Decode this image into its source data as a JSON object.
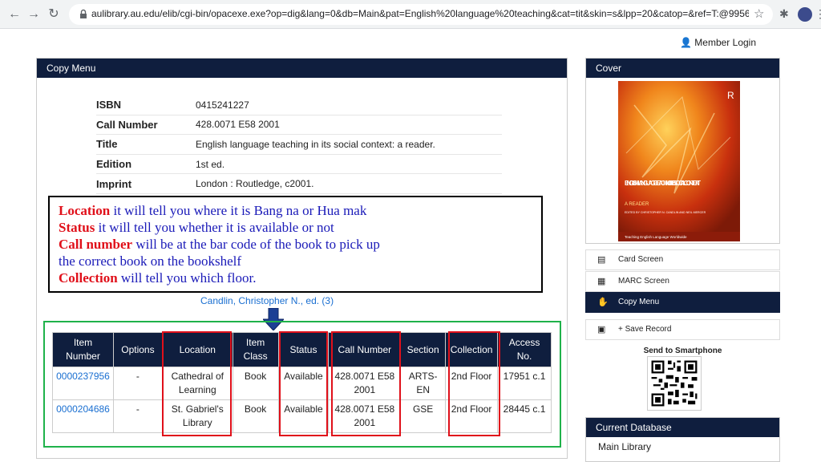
{
  "browser": {
    "url": "aulibrary.au.edu/elib/cgi-bin/opacexe.exe?op=dig&lang=0&db=Main&pat=English%20language%20teaching&cat=tit&skin=s&lpp=20&catop=&ref=T:@995658&nx=1"
  },
  "header": {
    "member_login": "Member Login"
  },
  "copy_menu": {
    "title": "Copy Menu",
    "bib": [
      {
        "label": "ISBN",
        "value": "0415241227"
      },
      {
        "label": "Call Number",
        "value": "428.0071 E58 2001"
      },
      {
        "label": "Title",
        "value": "English language teaching in its social context: a reader."
      },
      {
        "label": "Edition",
        "value": "1st ed."
      },
      {
        "label": "Imprint",
        "value": "London : Routledge, c2001."
      }
    ],
    "note": [
      {
        "key": "Location",
        "text": " it will tell you where it is Bang na  or Hua mak"
      },
      {
        "key": "Status",
        "text": " it will tell you whether it is available or not"
      },
      {
        "key": "Call number",
        "text": " will be at the bar code of the book to pick up"
      },
      {
        "key": "",
        "text": "the correct book on the bookshelf"
      },
      {
        "key": "Collection",
        "text": " will tell you which floor."
      }
    ],
    "author_link": "Candlin, Christopher N., ed. (3)",
    "table": {
      "headers": [
        "Item Number",
        "Options",
        "Location",
        "Item Class",
        "Status",
        "Call Number",
        "Section",
        "Collection",
        "Access No."
      ],
      "rows": [
        [
          "0000237956",
          "-",
          "Cathedral of Learning",
          "Book",
          "Available",
          "428.0071 E58 2001",
          "ARTS-EN",
          "2nd Floor",
          "17951 c.1"
        ],
        [
          "0000204686",
          "-",
          "St. Gabriel's Library",
          "Book",
          "Available",
          "428.0071 E58 2001",
          "GSE",
          "2nd Floor",
          "28445 c.1"
        ]
      ]
    }
  },
  "cover": {
    "title": "Cover",
    "book_title": "ENGLISH LANGUAGE TEACHING IN ITS SOCIAL CONTEXT",
    "book_subtitle": "A READER",
    "book_editors": "EDITED BY CHRISTOPHER N. CANDLIN AND NEIL MERCER",
    "book_series": "Teaching English Language Worldwide",
    "publisher_mark": "R"
  },
  "sidebar": {
    "items": [
      {
        "label": "Card Screen",
        "icon": "card-icon"
      },
      {
        "label": "MARC Screen",
        "icon": "marc-icon"
      },
      {
        "label": "Copy Menu",
        "icon": "hand-icon"
      },
      {
        "label": "+ Save Record",
        "icon": "save-icon"
      }
    ],
    "send_to_smartphone": "Send to Smartphone"
  },
  "database": {
    "title": "Current Database",
    "value": "Main Library"
  },
  "colors": {
    "nav_bg": "#0f1e3e",
    "highlight_red": "#e0101a",
    "highlight_green": "#1fb24a",
    "link_blue": "#1a6fd1"
  }
}
